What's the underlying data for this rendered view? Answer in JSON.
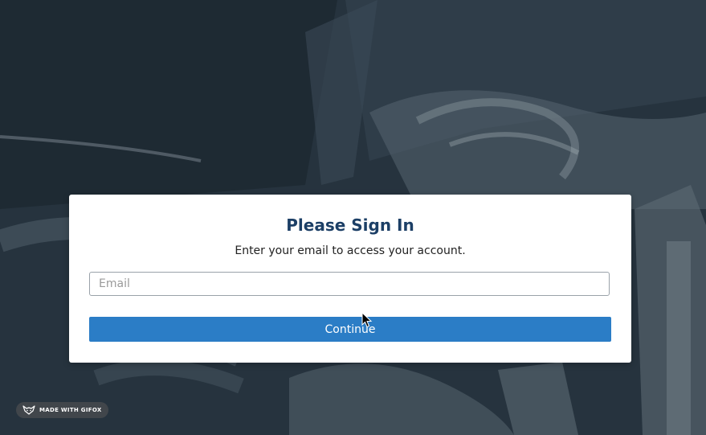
{
  "login": {
    "title": "Please Sign In",
    "subtitle": "Enter your email to access your account.",
    "email_placeholder": "Email",
    "email_value": "",
    "continue_label": "Continue"
  },
  "watermark": {
    "label": "MADE WITH GIFOX",
    "icon": "fox-icon"
  },
  "colors": {
    "title": "#1c3f66",
    "button": "#2b7dc6",
    "card": "#ffffff",
    "background": "#2a3946"
  }
}
